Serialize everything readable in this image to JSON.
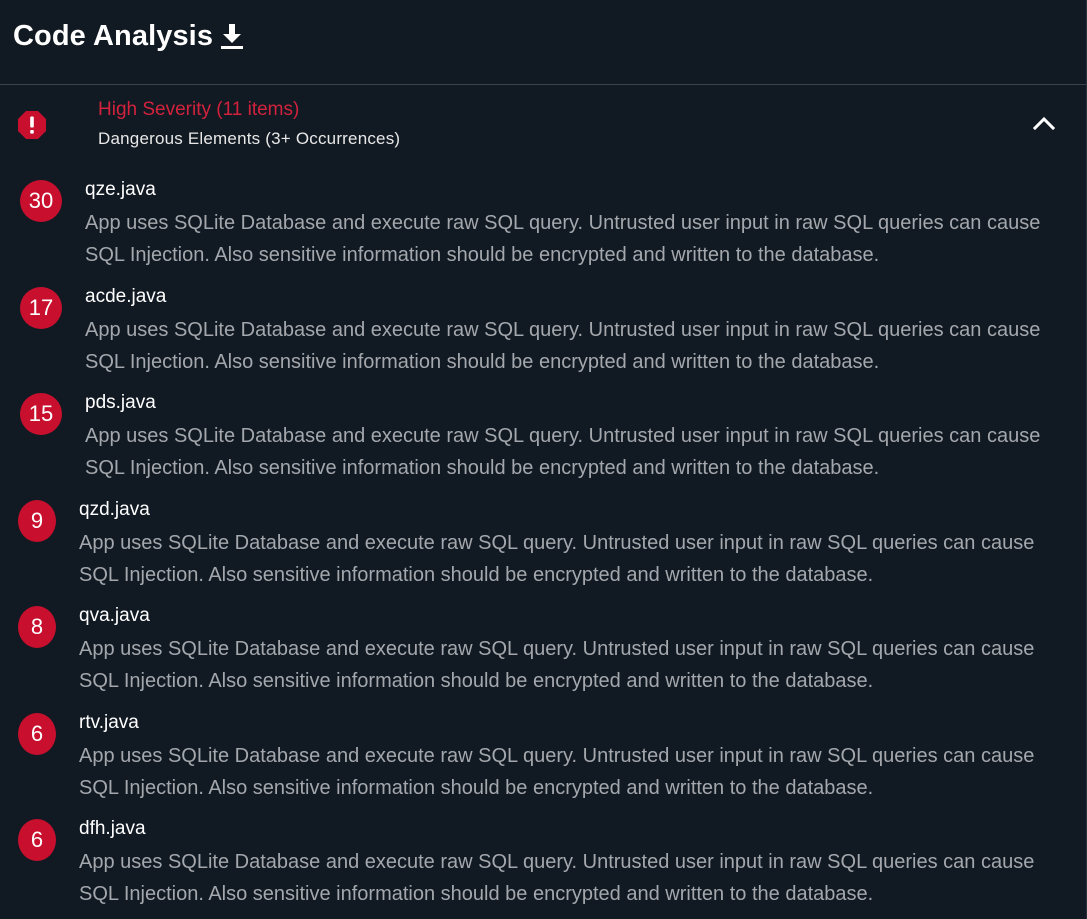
{
  "header": {
    "title": "Code Analysis",
    "download_icon": "download-icon"
  },
  "section": {
    "icon": "alert-octagon-icon",
    "title": "High Severity (11 items)",
    "subtitle": "Dangerous Elements (3+ Occurrences)",
    "toggle_icon": "chevron-up-icon",
    "accent_color": "#c8102e"
  },
  "items": [
    {
      "count": "30",
      "file": "qze.java",
      "description": "App uses SQLite Database and execute raw SQL query. Untrusted user input in raw SQL queries can cause SQL Injection. Also sensitive information should be encrypted and written to the database."
    },
    {
      "count": "17",
      "file": "acde.java",
      "description": "App uses SQLite Database and execute raw SQL query. Untrusted user input in raw SQL queries can cause SQL Injection. Also sensitive information should be encrypted and written to the database."
    },
    {
      "count": "15",
      "file": "pds.java",
      "description": "App uses SQLite Database and execute raw SQL query. Untrusted user input in raw SQL queries can cause SQL Injection. Also sensitive information should be encrypted and written to the database."
    },
    {
      "count": "9",
      "file": "qzd.java",
      "description": "App uses SQLite Database and execute raw SQL query. Untrusted user input in raw SQL queries can cause SQL Injection. Also sensitive information should be encrypted and written to the database."
    },
    {
      "count": "8",
      "file": "qva.java",
      "description": "App uses SQLite Database and execute raw SQL query. Untrusted user input in raw SQL queries can cause SQL Injection. Also sensitive information should be encrypted and written to the database."
    },
    {
      "count": "6",
      "file": "rtv.java",
      "description": "App uses SQLite Database and execute raw SQL query. Untrusted user input in raw SQL queries can cause SQL Injection. Also sensitive information should be encrypted and written to the database."
    },
    {
      "count": "6",
      "file": "dfh.java",
      "description": "App uses SQLite Database and execute raw SQL query. Untrusted user input in raw SQL queries can cause SQL Injection. Also sensitive information should be encrypted and written to the database."
    }
  ]
}
